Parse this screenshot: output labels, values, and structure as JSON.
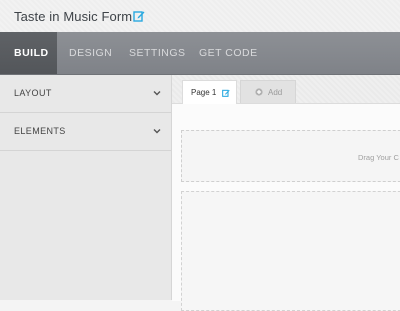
{
  "header": {
    "title": "Taste in Music Form",
    "edit_icon": "edit-icon",
    "accent": "#29a9e0"
  },
  "nav": {
    "tabs": [
      {
        "label": "BUILD",
        "active": true
      },
      {
        "label": "DESIGN",
        "active": false
      },
      {
        "label": "SETTINGS",
        "active": false
      },
      {
        "label": "GET CODE",
        "active": false
      }
    ]
  },
  "sidebar": {
    "items": [
      {
        "label": "LAYOUT",
        "icon": "chevron-down-icon"
      },
      {
        "label": "ELEMENTS",
        "icon": "chevron-down-icon"
      }
    ]
  },
  "pages": {
    "tabs": [
      {
        "label": "Page 1",
        "icon": "edit-icon",
        "active": true
      },
      {
        "label": "Add",
        "icon": "add-icon",
        "active": false
      }
    ]
  },
  "canvas": {
    "drop_text": "Drag Your C"
  }
}
